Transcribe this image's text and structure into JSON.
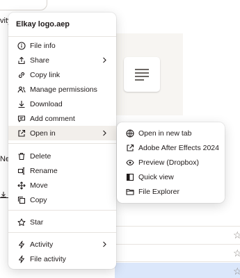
{
  "background": {
    "fragment_left": "vity",
    "fragment_new": "Nev"
  },
  "context_menu": {
    "title": "Elkay logo.aep",
    "items": [
      {
        "label": "File info",
        "icon": "info-icon"
      },
      {
        "label": "Share",
        "icon": "share-icon"
      },
      {
        "label": "Copy link",
        "icon": "link-icon"
      },
      {
        "label": "Manage permissions",
        "icon": "people-icon"
      },
      {
        "label": "Download",
        "icon": "download-icon"
      },
      {
        "label": "Add comment",
        "icon": "comment-icon"
      },
      {
        "label": "Open in",
        "icon": "open-external-icon"
      },
      {
        "label": "Delete",
        "icon": "trash-icon"
      },
      {
        "label": "Rename",
        "icon": "rename-icon"
      },
      {
        "label": "Move",
        "icon": "move-icon"
      },
      {
        "label": "Copy",
        "icon": "copy-icon"
      },
      {
        "label": "Star",
        "icon": "star-icon"
      },
      {
        "label": "Activity",
        "icon": "activity-icon"
      },
      {
        "label": "File activity",
        "icon": "file-activity-icon"
      }
    ]
  },
  "open_in_submenu": {
    "items": [
      {
        "label": "Open in new tab",
        "icon": "globe-icon"
      },
      {
        "label": "Adobe After Effects 2024",
        "icon": "open-external-icon"
      },
      {
        "label": "Preview (Dropbox)",
        "icon": "eye-icon"
      },
      {
        "label": "Quick view",
        "icon": "quick-view-icon"
      },
      {
        "label": "File Explorer",
        "icon": "folder-icon"
      }
    ]
  },
  "colors": {
    "active_item_bg": "#f2efeb",
    "selected_row_bg": "#dbe7fb",
    "text": "#1e1919"
  }
}
